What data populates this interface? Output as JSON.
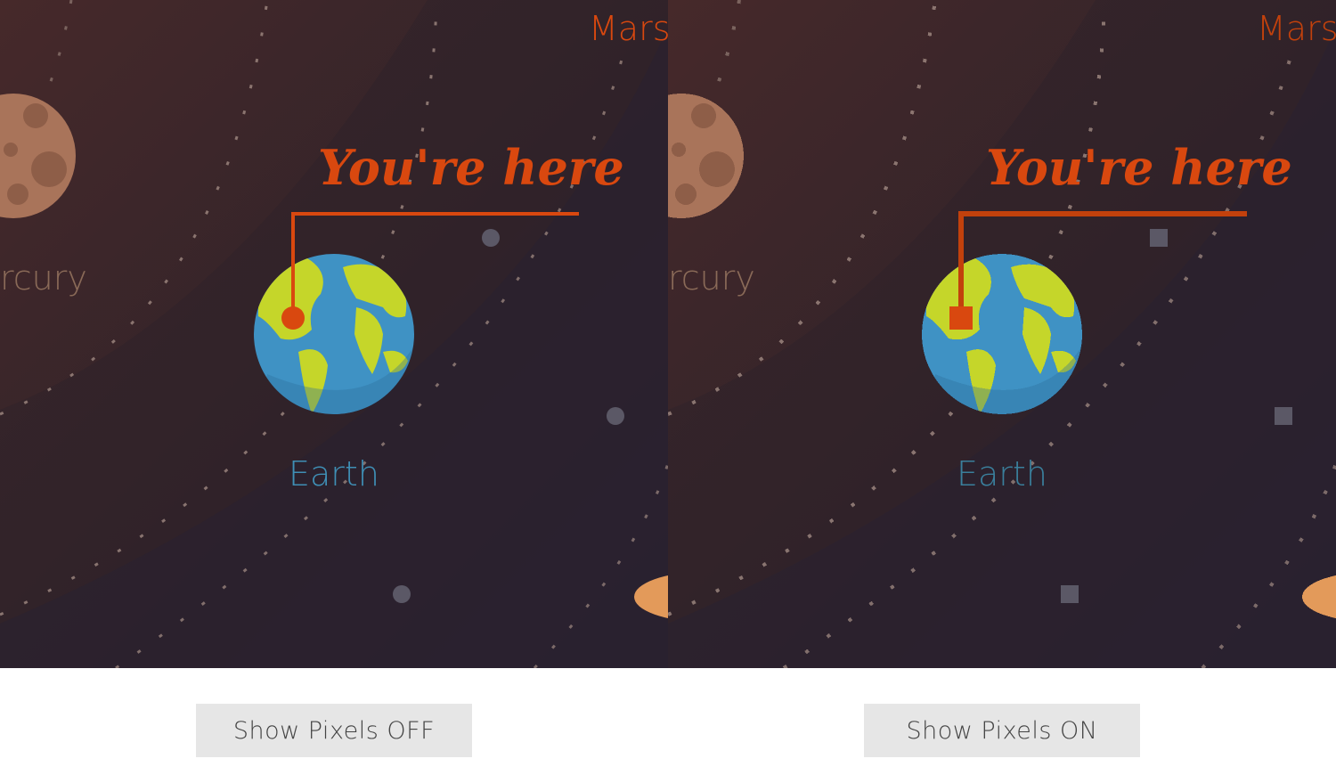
{
  "scene": {
    "labels": {
      "mars": "Mars",
      "mercury": "rcury",
      "earth": "Earth",
      "you_are_here": "You're here"
    },
    "colors": {
      "background_warm": "#3f2826",
      "background_cool": "#262036",
      "orbit": "#a08a82",
      "accent": "#d9480f",
      "earth_label": "#3f8fb5",
      "mercury_label": "#8a6a58",
      "ocean": "#3f92c4",
      "land": "#c5d62a",
      "planet_mercury": "#a9745a",
      "moon_dot": "#5b5866",
      "sun_edge": "#e39a5a"
    }
  },
  "buttons": {
    "pixels_off": "Show Pixels OFF",
    "pixels_on": "Show Pixels ON"
  }
}
